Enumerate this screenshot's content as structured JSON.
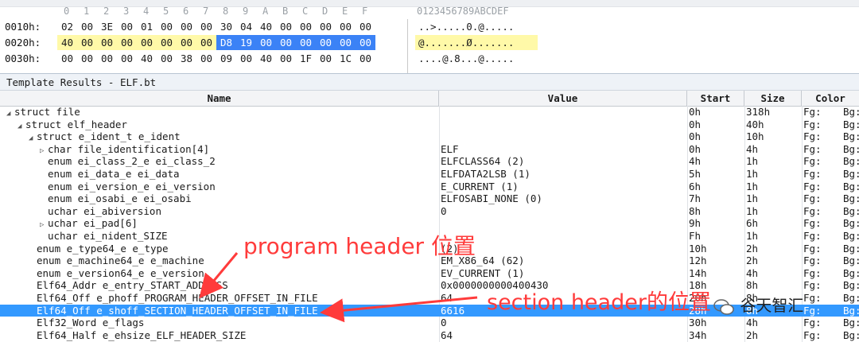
{
  "hex": {
    "column_headers": [
      "0",
      "1",
      "2",
      "3",
      "4",
      "5",
      "6",
      "7",
      "8",
      "9",
      "A",
      "B",
      "C",
      "D",
      "E",
      "F"
    ],
    "ascii_header": "0123456789ABCDEF",
    "rows": [
      {
        "addr": "0010h:",
        "bytes": [
          "02",
          "00",
          "3E",
          "00",
          "01",
          "00",
          "00",
          "00",
          "30",
          "04",
          "40",
          "00",
          "00",
          "00",
          "00",
          "00"
        ],
        "ascii": "..>.....0.@....."
      },
      {
        "addr": "0020h:",
        "bytes": [
          "40",
          "00",
          "00",
          "00",
          "00",
          "00",
          "00",
          "00",
          "D8",
          "19",
          "00",
          "00",
          "00",
          "00",
          "00",
          "00"
        ],
        "ascii": "@.......Ø......."
      },
      {
        "addr": "0030h:",
        "bytes": [
          "00",
          "00",
          "00",
          "00",
          "40",
          "00",
          "38",
          "00",
          "09",
          "00",
          "40",
          "00",
          "1F",
          "00",
          "1C",
          "00"
        ],
        "ascii": "....@.8...@....."
      }
    ]
  },
  "template": {
    "title": "Template Results - ELF.bt",
    "columns": {
      "name": "Name",
      "value": "Value",
      "start": "Start",
      "size": "Size",
      "color": "Color"
    },
    "rows": [
      {
        "indent": 0,
        "exp": "open",
        "name": "struct file",
        "value": "",
        "start": "0h",
        "size": "318h",
        "fg": "Fg:",
        "bg": "Bg:"
      },
      {
        "indent": 1,
        "exp": "open",
        "name": "struct elf_header",
        "value": "",
        "start": "0h",
        "size": "40h",
        "fg": "Fg:",
        "bg": "Bg:"
      },
      {
        "indent": 2,
        "exp": "open",
        "name": "struct e_ident_t e_ident",
        "value": "",
        "start": "0h",
        "size": "10h",
        "fg": "Fg:",
        "bg": "Bg:"
      },
      {
        "indent": 3,
        "exp": "closed",
        "name": "char file_identification[4]",
        "value": "ELF",
        "start": "0h",
        "size": "4h",
        "fg": "Fg:",
        "bg": "Bg:"
      },
      {
        "indent": 3,
        "exp": "",
        "name": "enum ei_class_2_e ei_class_2",
        "value": "ELFCLASS64 (2)",
        "start": "4h",
        "size": "1h",
        "fg": "Fg:",
        "bg": "Bg:"
      },
      {
        "indent": 3,
        "exp": "",
        "name": "enum ei_data_e ei_data",
        "value": "ELFDATA2LSB (1)",
        "start": "5h",
        "size": "1h",
        "fg": "Fg:",
        "bg": "Bg:"
      },
      {
        "indent": 3,
        "exp": "",
        "name": "enum ei_version_e ei_version",
        "value": "E_CURRENT (1)",
        "start": "6h",
        "size": "1h",
        "fg": "Fg:",
        "bg": "Bg:"
      },
      {
        "indent": 3,
        "exp": "",
        "name": "enum ei_osabi_e ei_osabi",
        "value": "ELFOSABI_NONE (0)",
        "start": "7h",
        "size": "1h",
        "fg": "Fg:",
        "bg": "Bg:"
      },
      {
        "indent": 3,
        "exp": "",
        "name": "uchar ei_abiversion",
        "value": "0",
        "start": "8h",
        "size": "1h",
        "fg": "Fg:",
        "bg": "Bg:"
      },
      {
        "indent": 3,
        "exp": "closed",
        "name": "uchar ei_pad[6]",
        "value": "",
        "start": "9h",
        "size": "6h",
        "fg": "Fg:",
        "bg": "Bg:"
      },
      {
        "indent": 3,
        "exp": "",
        "name": "uchar ei_nident_SIZE",
        "value": "",
        "start": "Fh",
        "size": "1h",
        "fg": "Fg:",
        "bg": "Bg:"
      },
      {
        "indent": 2,
        "exp": "",
        "name": "enum e_type64_e e_type",
        "value": "(2)",
        "start": "10h",
        "size": "2h",
        "fg": "Fg:",
        "bg": "Bg:"
      },
      {
        "indent": 2,
        "exp": "",
        "name": "enum e_machine64_e e_machine",
        "value": "EM_X86_64 (62)",
        "start": "12h",
        "size": "2h",
        "fg": "Fg:",
        "bg": "Bg:"
      },
      {
        "indent": 2,
        "exp": "",
        "name": "enum e_version64_e e_version",
        "value": "EV_CURRENT (1)",
        "start": "14h",
        "size": "4h",
        "fg": "Fg:",
        "bg": "Bg:"
      },
      {
        "indent": 2,
        "exp": "",
        "name": "Elf64_Addr e_entry_START_ADDRESS",
        "value": "0x0000000000400430",
        "start": "18h",
        "size": "8h",
        "fg": "Fg:",
        "bg": "Bg:"
      },
      {
        "indent": 2,
        "exp": "",
        "name": "Elf64_Off e_phoff_PROGRAM_HEADER_OFFSET_IN_FILE",
        "value": "64",
        "start": "20h",
        "size": "8h",
        "fg": "Fg:",
        "bg": "Bg:"
      },
      {
        "indent": 2,
        "exp": "",
        "name": "Elf64_Off e_shoff_SECTION_HEADER_OFFSET_IN_FILE",
        "value": "6616",
        "start": "28h",
        "size": "8h",
        "fg": "Fg:",
        "bg": "Bg:",
        "selected": true
      },
      {
        "indent": 2,
        "exp": "",
        "name": "Elf32_Word e_flags",
        "value": "0",
        "start": "30h",
        "size": "4h",
        "fg": "Fg:",
        "bg": "Bg:"
      },
      {
        "indent": 2,
        "exp": "",
        "name": "Elf64_Half e_ehsize_ELF_HEADER_SIZE",
        "value": "64",
        "start": "34h",
        "size": "2h",
        "fg": "Fg:",
        "bg": "Bg:"
      }
    ]
  },
  "annotations": {
    "program_header": "program header 位置",
    "section_header": "section header的位置",
    "color": "#ff3b3b"
  },
  "watermark": {
    "text": "谷天智汇"
  }
}
